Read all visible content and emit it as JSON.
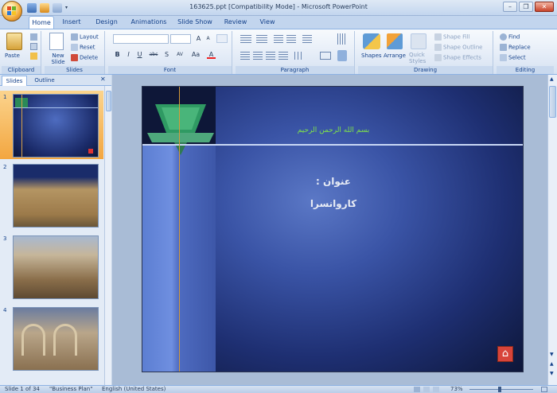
{
  "window": {
    "title": "163625.ppt [Compatibility Mode] - Microsoft PowerPoint",
    "minimize": "–",
    "restore": "❐",
    "close": "✕"
  },
  "tabs": [
    "Home",
    "Insert",
    "Design",
    "Animations",
    "Slide Show",
    "Review",
    "View"
  ],
  "ribbon": {
    "clipboard": {
      "label": "Clipboard",
      "paste": "Paste"
    },
    "slides": {
      "label": "Slides",
      "new_slide": "New Slide",
      "layout": "Layout",
      "reset": "Reset",
      "delete": "Delete"
    },
    "font": {
      "label": "Font",
      "bold": "B",
      "italic": "I",
      "underline": "U",
      "strike": "abc",
      "shadow": "S",
      "spacing": "AV",
      "case": "Aa",
      "grow": "A",
      "shrink": "A",
      "color": "A"
    },
    "paragraph": {
      "label": "Paragraph"
    },
    "drawing": {
      "label": "Drawing",
      "shapes": "Shapes",
      "arrange": "Arrange",
      "quick_styles": "Quick Styles",
      "shape_fill": "Shape Fill",
      "shape_outline": "Shape Outline",
      "shape_effects": "Shape Effects"
    },
    "editing": {
      "label": "Editing",
      "find": "Find",
      "replace": "Replace",
      "select": "Select"
    }
  },
  "left_pane": {
    "tabs": [
      "Slides",
      "Outline"
    ],
    "thumbnails": [
      {
        "num": "1",
        "selected": true,
        "kind": "title"
      },
      {
        "num": "2",
        "selected": false,
        "kind": "photo-text"
      },
      {
        "num": "3",
        "selected": false,
        "kind": "photo-text"
      },
      {
        "num": "4",
        "selected": false,
        "kind": "photo-arch"
      }
    ]
  },
  "slide": {
    "header_text": "بسم الله الرحمن الرحيم",
    "title_label": "عنوان :",
    "title_value": "کاروانسرا",
    "home_button": "⌂"
  },
  "statusbar": {
    "slide_info": "Slide 1 of 34",
    "theme": "\"Business Plan\"",
    "language": "English (United States)",
    "zoom": "73%"
  },
  "colors": {
    "accent_orange": "#f5a638",
    "ribbon_blue": "#15428b",
    "slide_header_green": "#7fe34a"
  }
}
